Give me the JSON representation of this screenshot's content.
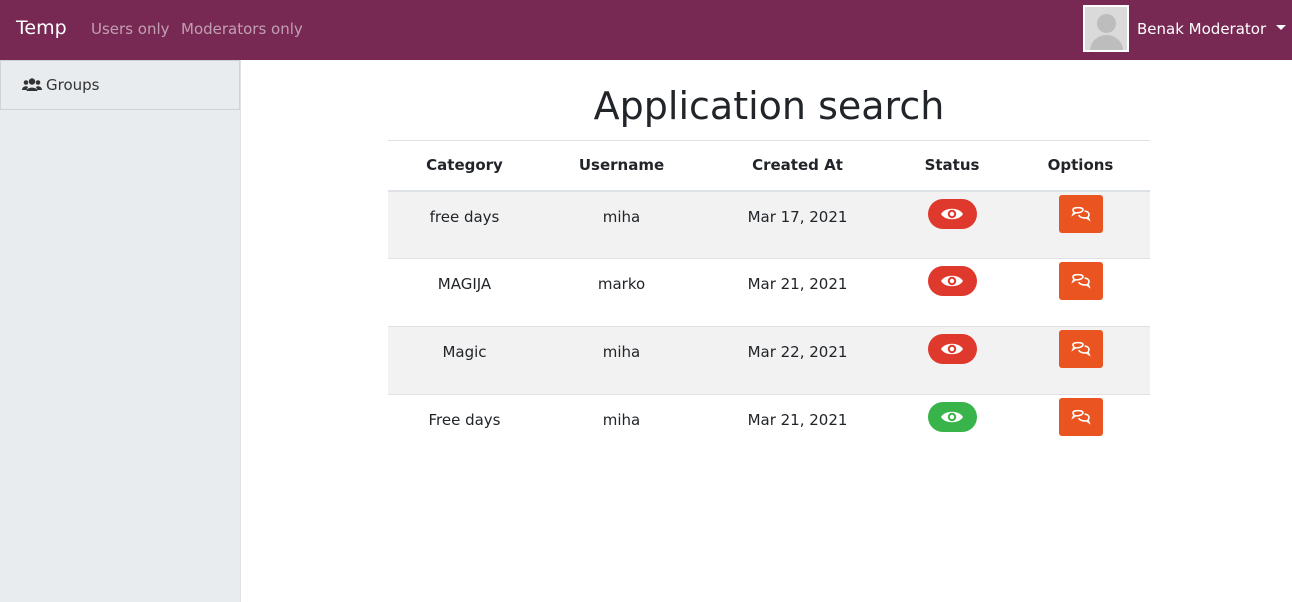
{
  "navbar": {
    "brand": "Temp",
    "links": [
      "Users only",
      "Moderators only"
    ],
    "user_name": "Benak Moderator"
  },
  "sidebar": {
    "items": [
      {
        "label": "Groups",
        "icon": "users-icon"
      }
    ]
  },
  "main": {
    "title": "Application search",
    "table": {
      "headers": [
        "Category",
        "Username",
        "Created At",
        "Status",
        "Options"
      ],
      "rows": [
        {
          "category": "free days",
          "username": "miha",
          "created_at": "Mar 17, 2021",
          "status": "red"
        },
        {
          "category": "MAGIJA",
          "username": "marko",
          "created_at": "Mar 21, 2021",
          "status": "red"
        },
        {
          "category": "Magic",
          "username": "miha",
          "created_at": "Mar 22, 2021",
          "status": "red"
        },
        {
          "category": "Free days",
          "username": "miha",
          "created_at": "Mar 21, 2021",
          "status": "green"
        }
      ]
    }
  },
  "colors": {
    "navbar": "#772953",
    "status_red": "#df382c",
    "status_green": "#38b44a",
    "options": "#e95420"
  }
}
